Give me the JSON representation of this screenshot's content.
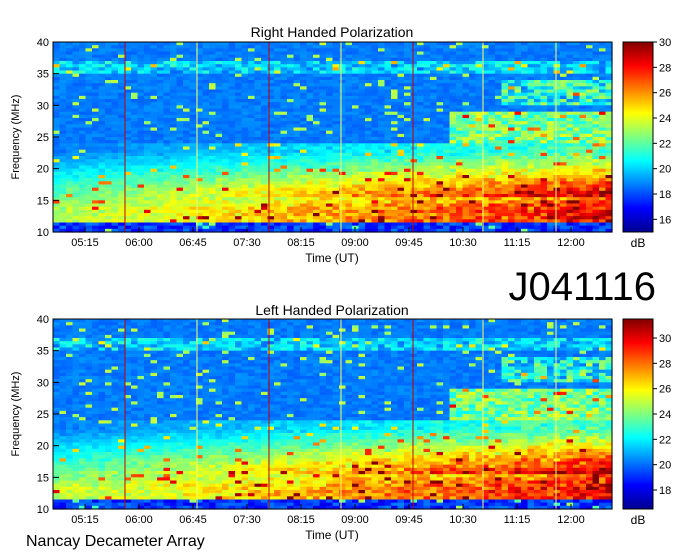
{
  "figure": {
    "code": "J041116",
    "footer": "Nancay Decameter Array"
  },
  "chart_data": [
    {
      "type": "heatmap",
      "title": "Right Handed Polarization",
      "xlabel": "Time (UT)",
      "ylabel": "Frequency (MHz)",
      "x_ticks": [
        "05:15",
        "06:00",
        "06:45",
        "07:30",
        "08:15",
        "09:00",
        "09:45",
        "10:30",
        "11:15",
        "12:00"
      ],
      "y_ticks": [
        10,
        15,
        20,
        25,
        30,
        35,
        40
      ],
      "ylim": [
        10,
        40
      ],
      "colorbar": {
        "label": "dB",
        "ticks": [
          16,
          18,
          20,
          22,
          24,
          26,
          28,
          30
        ],
        "range": [
          15,
          30
        ]
      },
      "colormap": [
        "#00008f",
        "#0000ff",
        "#00ffff",
        "#ffff00",
        "#ff0000",
        "#800000"
      ]
    },
    {
      "type": "heatmap",
      "title": "Left Handed Polarization",
      "xlabel": "Time (UT)",
      "ylabel": "Frequency (MHz)",
      "x_ticks": [
        "05:15",
        "06:00",
        "06:45",
        "07:30",
        "08:15",
        "09:00",
        "09:45",
        "10:30",
        "11:15",
        "12:00"
      ],
      "y_ticks": [
        10,
        15,
        20,
        25,
        30,
        35,
        40
      ],
      "ylim": [
        10,
        40
      ],
      "colorbar": {
        "label": "dB",
        "ticks": [
          18,
          20,
          22,
          24,
          26,
          28,
          30
        ],
        "range": [
          16.5,
          31.5
        ]
      },
      "colormap": [
        "#00008f",
        "#0000ff",
        "#00ffff",
        "#ffff00",
        "#ff0000",
        "#800000"
      ]
    }
  ]
}
